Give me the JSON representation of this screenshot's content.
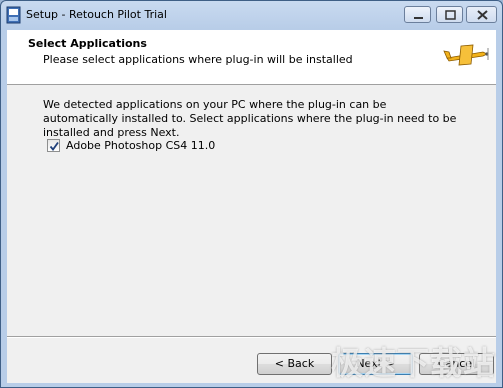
{
  "window": {
    "title": "Setup - Retouch Pilot Trial"
  },
  "header": {
    "title": "Select Applications",
    "subtitle": "Please select applications where plug-in will be installed",
    "logo_icon": "airplane-icon"
  },
  "body": {
    "description": "We detected applications on your PC where the plug-in can be automatically installed to. Select applications where the plug-in need to be installed and press Next.",
    "applications": [
      {
        "label": "Adobe Photoshop CS4 11.0",
        "checked": true
      }
    ]
  },
  "buttons": {
    "back": "< Back",
    "next": "Next >",
    "cancel": "Cancel"
  },
  "watermark": "极速下载站",
  "colors": {
    "title_bar": "#b8cde8",
    "client_bg": "#f0f0f0",
    "header_bg": "#ffffff",
    "plane_yellow": "#f2b21b"
  }
}
